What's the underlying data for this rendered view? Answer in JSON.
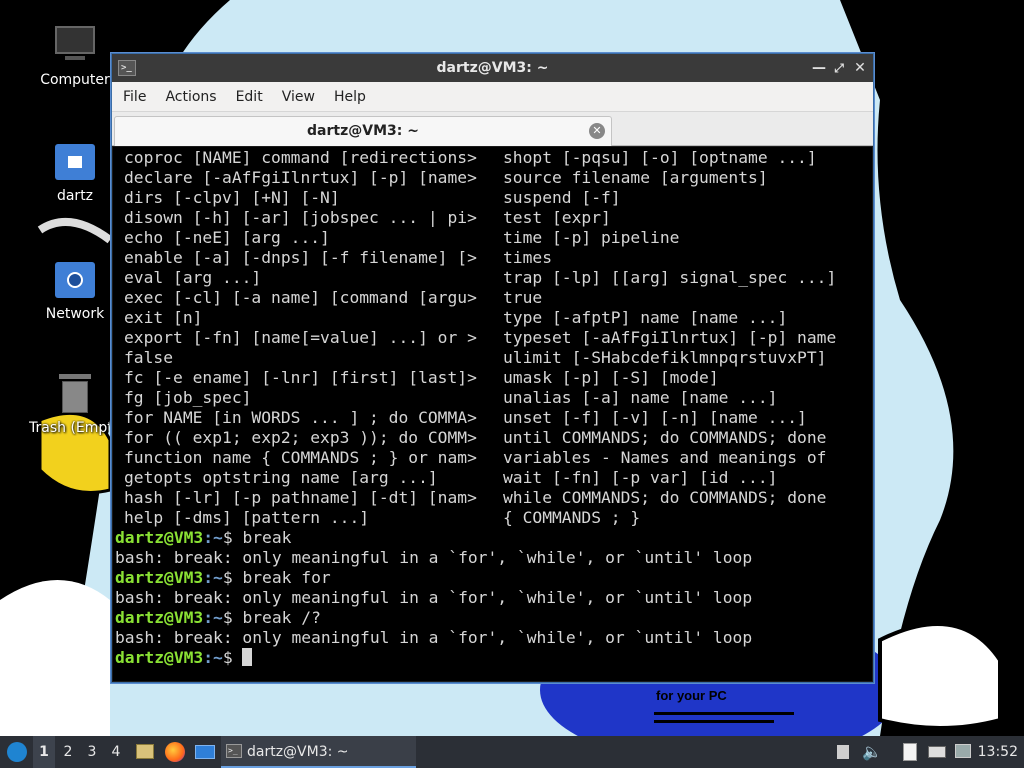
{
  "desktop": {
    "icons": [
      {
        "label": "Computer"
      },
      {
        "label": "dartz"
      },
      {
        "label": "Network"
      },
      {
        "label": "Trash (Empty)"
      }
    ],
    "wallpaper_text": "for your PC"
  },
  "window": {
    "title": "dartz@VM3: ~",
    "menu": [
      "File",
      "Actions",
      "Edit",
      "View",
      "Help"
    ],
    "tab_label": "dartz@VM3: ~"
  },
  "terminal": {
    "help_rows": [
      [
        "coproc [NAME] command [redirections>",
        "shopt [-pqsu] [-o] [optname ...]"
      ],
      [
        "declare [-aAfFgiIlnrtux] [-p] [name>",
        "source filename [arguments]"
      ],
      [
        "dirs [-clpv] [+N] [-N]",
        "suspend [-f]"
      ],
      [
        "disown [-h] [-ar] [jobspec ... | pi>",
        "test [expr]"
      ],
      [
        "echo [-neE] [arg ...]",
        "time [-p] pipeline"
      ],
      [
        "enable [-a] [-dnps] [-f filename] [>",
        "times"
      ],
      [
        "eval [arg ...]",
        "trap [-lp] [[arg] signal_spec ...]"
      ],
      [
        "exec [-cl] [-a name] [command [argu>",
        "true"
      ],
      [
        "exit [n]",
        "type [-afptP] name [name ...]"
      ],
      [
        "export [-fn] [name[=value] ...] or >",
        "typeset [-aAfFgiIlnrtux] [-p] name"
      ],
      [
        "false",
        "ulimit [-SHabcdefiklmnpqrstuvxPT]"
      ],
      [
        "fc [-e ename] [-lnr] [first] [last]>",
        "umask [-p] [-S] [mode]"
      ],
      [
        "fg [job_spec]",
        "unalias [-a] name [name ...]"
      ],
      [
        "for NAME [in WORDS ... ] ; do COMMA>",
        "unset [-f] [-v] [-n] [name ...]"
      ],
      [
        "for (( exp1; exp2; exp3 )); do COMM>",
        "until COMMANDS; do COMMANDS; done"
      ],
      [
        "function name { COMMANDS ; } or nam>",
        "variables - Names and meanings of"
      ],
      [
        "getopts optstring name [arg ...]",
        "wait [-fn] [-p var] [id ...]"
      ],
      [
        "hash [-lr] [-p pathname] [-dt] [nam>",
        "while COMMANDS; do COMMANDS; done"
      ],
      [
        "help [-dms] [pattern ...]",
        "{ COMMANDS ; }"
      ]
    ],
    "prompt_user": "dartz@VM3",
    "prompt_path": ":~",
    "prompt_sign": "$ ",
    "session": [
      {
        "command": "break",
        "output": "bash: break: only meaningful in a `for', `while', or `until' loop"
      },
      {
        "command": "break for",
        "output": "bash: break: only meaningful in a `for', `while', or `until' loop"
      },
      {
        "command": "break /?",
        "output": "bash: break: only meaningful in a `for', `while', or `until' loop"
      }
    ]
  },
  "taskbar": {
    "workspaces": [
      "1",
      "2",
      "3",
      "4"
    ],
    "active_workspace": "1",
    "task_label": "dartz@VM3: ~",
    "clock": "13:52"
  },
  "colors": {
    "prompt_green": "#8ae234",
    "path_blue": "#729fcf",
    "taskbar_bg": "#2b2f36",
    "titlebar_bg": "#3a3a3a"
  }
}
